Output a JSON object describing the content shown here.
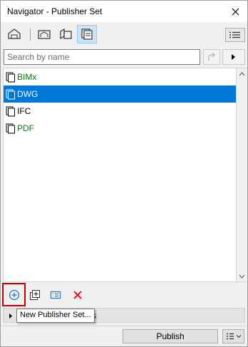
{
  "window": {
    "title": "Navigator - Publisher Set"
  },
  "toolbar": {
    "buttons": [
      {
        "icon": "project-map-icon"
      },
      {
        "icon": "view-map-icon"
      },
      {
        "icon": "layout-book-icon"
      },
      {
        "icon": "publisher-sets-icon",
        "active": true
      }
    ],
    "menu_icon": "hamburger-menu-icon"
  },
  "search": {
    "placeholder": "Search by name",
    "value": ""
  },
  "list": {
    "items": [
      {
        "label": "BIMx",
        "color": "#008000",
        "selected": false
      },
      {
        "label": "DWG",
        "color": "#ffffff",
        "selected": true
      },
      {
        "label": "IFC",
        "color": "#000000",
        "selected": false
      },
      {
        "label": "PDF",
        "color": "#008000",
        "selected": false
      }
    ]
  },
  "bottom_tools": {
    "buttons": [
      {
        "icon": "new-publisher-set-icon"
      },
      {
        "icon": "add-item-icon"
      },
      {
        "icon": "settings-list-icon"
      },
      {
        "icon": "delete-icon"
      }
    ]
  },
  "collapsed_section": {
    "label_tail": "s"
  },
  "tooltip": {
    "text": "New Publisher Set..."
  },
  "footer": {
    "publish_label": "Publish"
  },
  "colors": {
    "selection": "#0078d7",
    "accent_blue": "#1a73c8",
    "delete_red": "#e81123",
    "highlight_red": "#c00000"
  }
}
